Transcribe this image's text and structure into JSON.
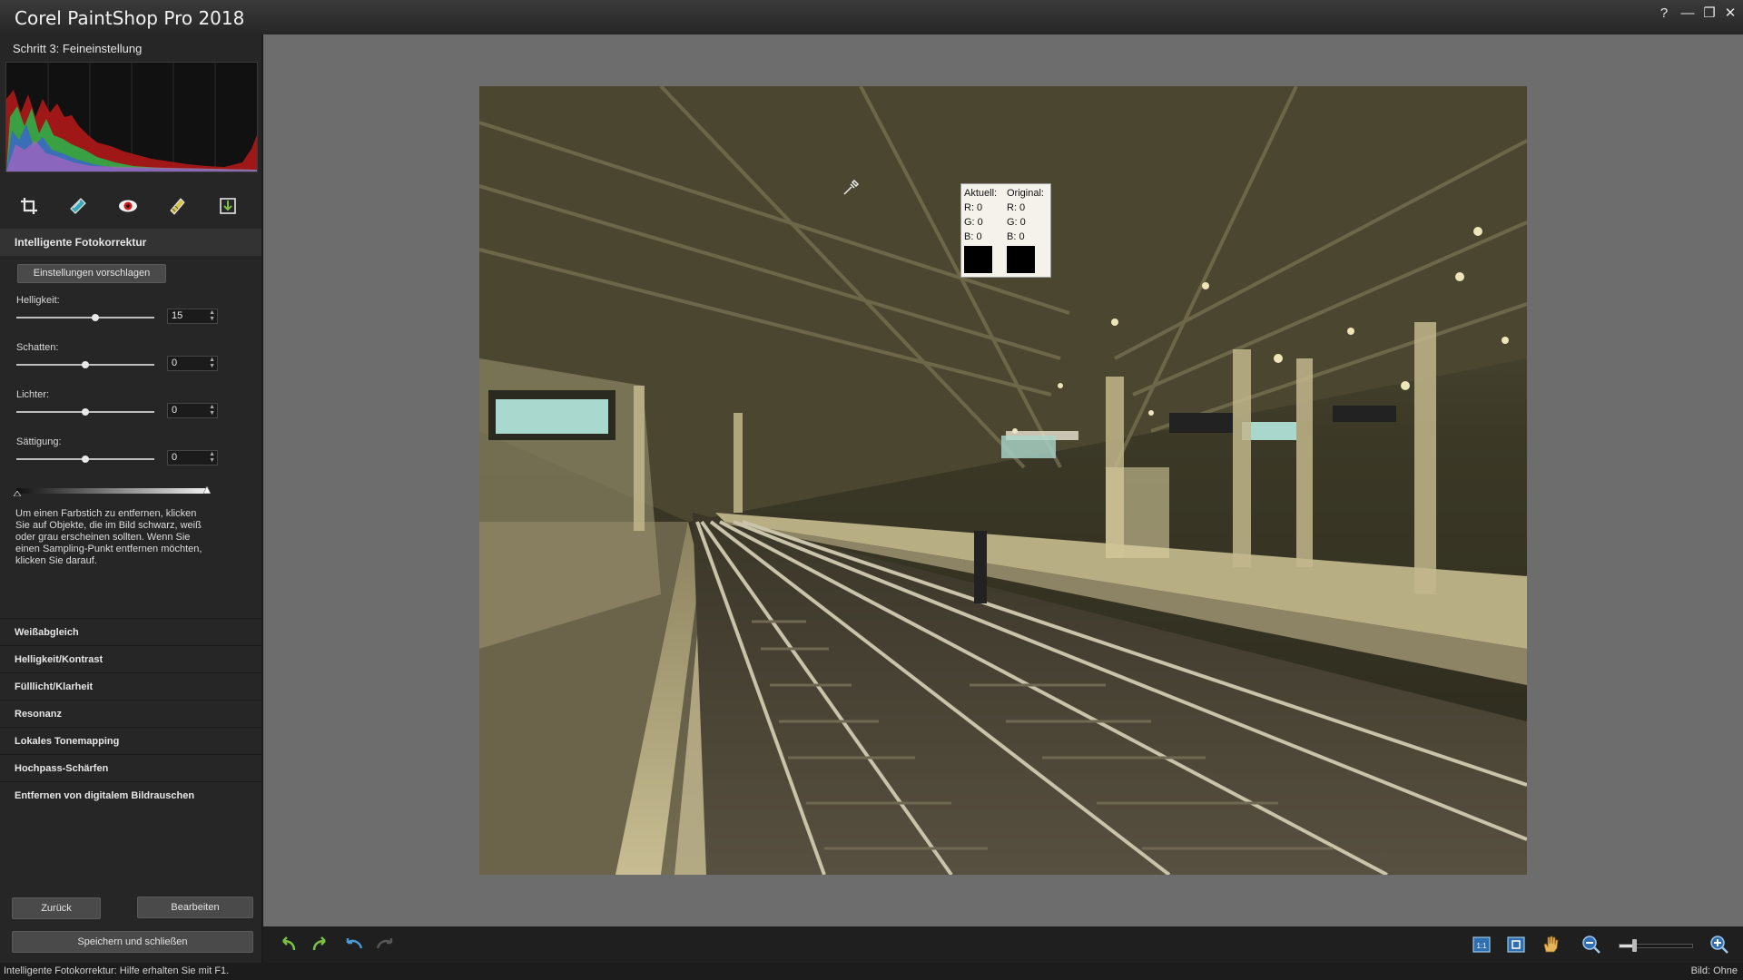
{
  "window": {
    "title": "Corel PaintShop Pro 2018",
    "controls": [
      "?",
      "—",
      "❐",
      "✕"
    ]
  },
  "panel": {
    "step_title": "Schritt 3: Feineinstellung",
    "section_title": "Intelligente Fotokorrektur",
    "suggest_button": "Einstellungen vorschlagen",
    "sliders": [
      {
        "label": "Helligkeit:",
        "value": "15",
        "level": 0.57
      },
      {
        "label": "Schatten:",
        "value": "0",
        "level": 0.5
      },
      {
        "label": "Lichter:",
        "value": "0",
        "level": 0.5
      },
      {
        "label": "Sättigung:",
        "value": "0",
        "level": 0.5
      }
    ],
    "help_text": "Um einen Farbstich zu entfernen, klicken Sie auf Objekte, die im Bild schwarz, weiß oder grau erscheinen sollten. Wenn Sie einen Sampling-Punkt entfernen möchten, klicken Sie darauf.",
    "accordion": [
      "Weißabgleich",
      "Helligkeit/Kontrast",
      "Fülllicht/Klarheit",
      "Resonanz",
      "Lokales Tonemapping",
      "Hochpass-Schärfen",
      "Entfernen von digitalem Bildrauschen"
    ],
    "back_button": "Zurück",
    "edit_button": "Bearbeiten",
    "save_close_button": "Speichern und schließen"
  },
  "sampler": {
    "current_label": "Aktuell:",
    "original_label": "Original:",
    "current": {
      "r": "R: 0",
      "g": "G: 0",
      "b": "B: 0"
    },
    "original": {
      "r": "R: 0",
      "g": "G: 0",
      "b": "B: 0"
    }
  },
  "status": {
    "left": "Intelligente Fotokorrektur: Hilfe erhalten Sie mit F1.",
    "right": "Bild: Ohne"
  },
  "zoom_level": 0.2,
  "icons": [
    "crop-icon",
    "straighten-icon",
    "red-eye-icon",
    "retouch-icon",
    "resize-icon",
    "undo-icon",
    "redo-icon",
    "rotate-left-icon",
    "rotate-right-icon",
    "actual-size-icon",
    "fit-window-icon",
    "pan-hand-icon",
    "zoom-out-icon",
    "zoom-in-icon"
  ]
}
